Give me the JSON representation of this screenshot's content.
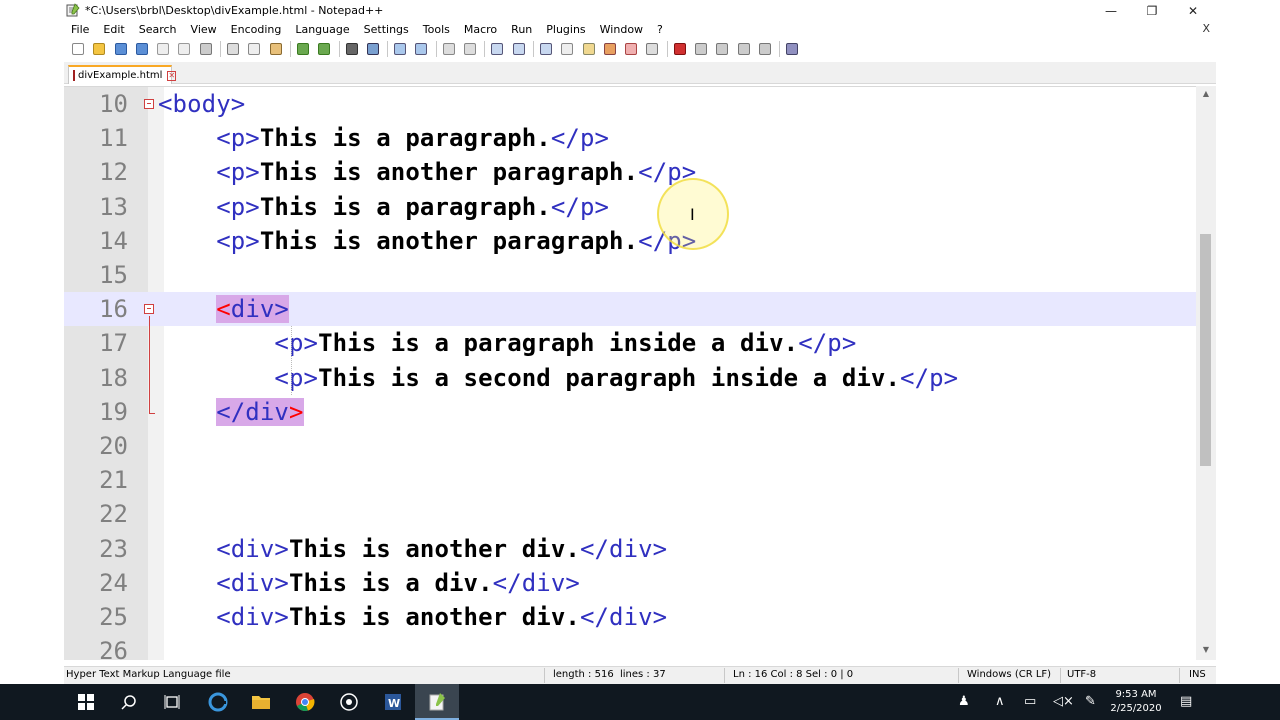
{
  "window": {
    "title": "*C:\\Users\\brbl\\Desktop\\divExample.html - Notepad++",
    "minimize": "—",
    "restore": "❐",
    "close": "✕"
  },
  "menu": {
    "items": [
      "File",
      "Edit",
      "Search",
      "View",
      "Encoding",
      "Language",
      "Settings",
      "Tools",
      "Macro",
      "Run",
      "Plugins",
      "Window",
      "?"
    ],
    "close": "X"
  },
  "tab": {
    "label": "divExample.html",
    "close": "✕"
  },
  "editor": {
    "lines": [
      {
        "num": "10",
        "fold": "open",
        "parts": [
          [
            "tag",
            "<body>"
          ]
        ]
      },
      {
        "num": "11",
        "parts": [
          [
            "pad",
            "    "
          ],
          [
            "tag",
            "<p>"
          ],
          [
            "txt",
            "This is a paragraph."
          ],
          [
            "tag",
            "</p>"
          ]
        ]
      },
      {
        "num": "12",
        "parts": [
          [
            "pad",
            "    "
          ],
          [
            "tag",
            "<p>"
          ],
          [
            "txt",
            "This is another paragraph."
          ],
          [
            "tag",
            "</p>"
          ]
        ]
      },
      {
        "num": "13",
        "parts": [
          [
            "pad",
            "    "
          ],
          [
            "tag",
            "<p>"
          ],
          [
            "txt",
            "This is a paragraph."
          ],
          [
            "tag",
            "</p>"
          ]
        ]
      },
      {
        "num": "14",
        "parts": [
          [
            "pad",
            "    "
          ],
          [
            "tag",
            "<p>"
          ],
          [
            "txt",
            "This is another paragraph."
          ],
          [
            "tag",
            "</p>"
          ]
        ]
      },
      {
        "num": "15",
        "parts": []
      },
      {
        "num": "16",
        "fold": "open",
        "current": true,
        "parts": [
          [
            "pad",
            "    "
          ],
          [
            "hlb",
            "<"
          ],
          [
            "hlt",
            "div"
          ],
          [
            "hlt",
            ">"
          ]
        ]
      },
      {
        "num": "17",
        "parts": [
          [
            "pad",
            "        "
          ],
          [
            "tag",
            "<p>"
          ],
          [
            "txt",
            "This is a paragraph inside a div."
          ],
          [
            "tag",
            "</p>"
          ]
        ]
      },
      {
        "num": "18",
        "parts": [
          [
            "pad",
            "        "
          ],
          [
            "tag",
            "<p>"
          ],
          [
            "txt",
            "This is a second paragraph inside a div."
          ],
          [
            "tag",
            "</p>"
          ]
        ]
      },
      {
        "num": "19",
        "parts": [
          [
            "pad",
            "    "
          ],
          [
            "hlt",
            "</div"
          ],
          [
            "hlb",
            ">"
          ]
        ]
      },
      {
        "num": "20",
        "parts": []
      },
      {
        "num": "21",
        "parts": []
      },
      {
        "num": "22",
        "parts": []
      },
      {
        "num": "23",
        "parts": [
          [
            "pad",
            "    "
          ],
          [
            "tag",
            "<div>"
          ],
          [
            "txt",
            "This is another div."
          ],
          [
            "tag",
            "</div>"
          ]
        ]
      },
      {
        "num": "24",
        "parts": [
          [
            "pad",
            "    "
          ],
          [
            "tag",
            "<div>"
          ],
          [
            "txt",
            "This is a div."
          ],
          [
            "tag",
            "</div>"
          ]
        ]
      },
      {
        "num": "25",
        "parts": [
          [
            "pad",
            "    "
          ],
          [
            "tag",
            "<div>"
          ],
          [
            "txt",
            "This is another div."
          ],
          [
            "tag",
            "</div>"
          ]
        ]
      },
      {
        "num": "26",
        "parts": []
      }
    ]
  },
  "status": {
    "file_type": "Hyper Text Markup Language file",
    "length": "length : 516",
    "lines": "lines : 37",
    "position": "Ln : 16    Col : 8    Sel : 0 | 0",
    "eol": "Windows (CR LF)",
    "encoding": "UTF-8",
    "mode": "INS"
  },
  "taskbar": {
    "time": "9:53 AM",
    "date": "2/25/2020"
  },
  "colors": {
    "tag": "#3030c0",
    "text": "#000000",
    "brace_highlight": "#d8a8e8",
    "brace_red": "#ff0000",
    "current_line": "#e8e8ff",
    "tab_accent": "#f9a825",
    "taskbar": "#101820"
  }
}
